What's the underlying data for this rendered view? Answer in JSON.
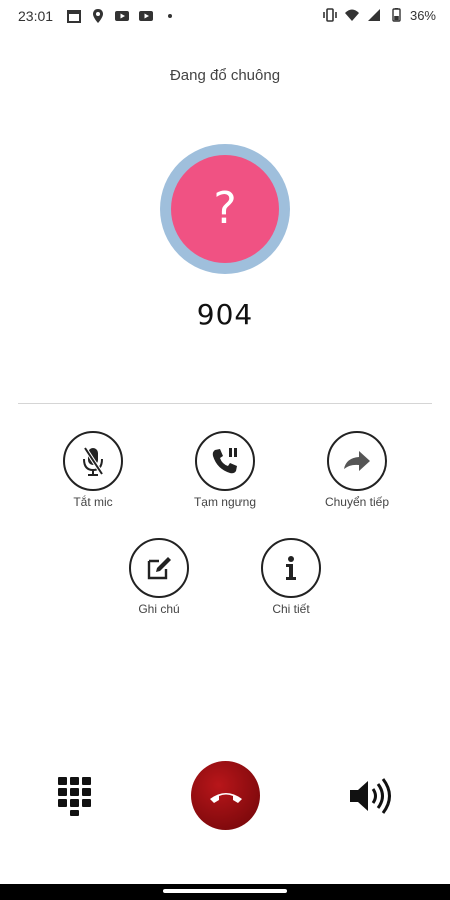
{
  "status_bar": {
    "time": "23:01",
    "battery": "36%",
    "left_icons": [
      "calendar-icon",
      "maps-icon",
      "youtube-icon",
      "youtube-icon",
      "dot-icon"
    ],
    "right_icons": [
      "vibrate-icon",
      "wifi-icon",
      "signal-icon",
      "battery-icon"
    ]
  },
  "call": {
    "status": "Đang đổ chuông",
    "avatar_glyph": "?",
    "number": "904",
    "colors": {
      "avatar_ring": "#9fbfdc",
      "avatar_fill": "#f05283",
      "end_call": "#a30f13"
    }
  },
  "actions": [
    {
      "label": "Tắt mic",
      "icon": "mic-off-icon"
    },
    {
      "label": "Tạm ngưng",
      "icon": "phone-pause-icon"
    },
    {
      "label": "Chuyển tiếp",
      "icon": "forward-arrow-icon"
    },
    {
      "label": "Ghi chú",
      "icon": "note-edit-icon"
    },
    {
      "label": "Chi tiết",
      "icon": "info-icon"
    }
  ],
  "bottom": {
    "keypad_icon": "dialpad-icon",
    "end_call_icon": "end-call-icon",
    "speaker_icon": "speaker-icon"
  }
}
